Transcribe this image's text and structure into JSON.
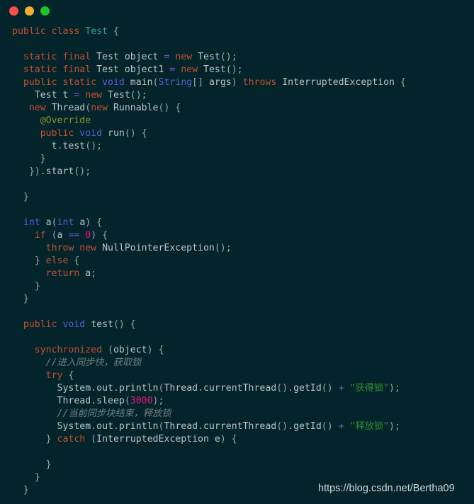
{
  "window": {
    "title": "",
    "traffic_lights": [
      {
        "name": "close",
        "color": "#fc4e4b"
      },
      {
        "name": "minimize",
        "color": "#f5ad2e"
      },
      {
        "name": "maximize",
        "color": "#1dc328"
      }
    ],
    "background": "#04242c"
  },
  "editor": {
    "language": "Java",
    "font_size_px": 13.2,
    "line_height_px": 18,
    "colors": {
      "background": "#04242c",
      "keyword": "#c1502e",
      "type": "#5a5fd4",
      "class_name": "#3a9e8a",
      "identifier": "#b9c4c4",
      "operator": "#7d57c6",
      "number": "#e0197d",
      "string": "#2f8f2f",
      "annotation": "#8a9127",
      "comment": "#6f8081",
      "punctuation": "#9aa7a7"
    },
    "lines": [
      {
        "n": 1,
        "tokens": [
          {
            "t": "kw",
            "v": "public"
          },
          {
            "t": "pun",
            "v": " "
          },
          {
            "t": "kw",
            "v": "class"
          },
          {
            "t": "pun",
            "v": " "
          },
          {
            "t": "cls",
            "v": "Test"
          },
          {
            "t": "pun",
            "v": " {"
          }
        ]
      },
      {
        "n": 2,
        "tokens": []
      },
      {
        "n": 3,
        "tokens": [
          {
            "t": "pun",
            "v": "  "
          },
          {
            "t": "kw",
            "v": "static"
          },
          {
            "t": "pun",
            "v": " "
          },
          {
            "t": "kw",
            "v": "final"
          },
          {
            "t": "pun",
            "v": " "
          },
          {
            "t": "id",
            "v": "Test object "
          },
          {
            "t": "op",
            "v": "="
          },
          {
            "t": "id",
            "v": " "
          },
          {
            "t": "kw",
            "v": "new"
          },
          {
            "t": "id",
            "v": " Test"
          },
          {
            "t": "pun",
            "v": "();"
          }
        ]
      },
      {
        "n": 4,
        "tokens": [
          {
            "t": "pun",
            "v": "  "
          },
          {
            "t": "kw",
            "v": "static"
          },
          {
            "t": "pun",
            "v": " "
          },
          {
            "t": "kw",
            "v": "final"
          },
          {
            "t": "pun",
            "v": " "
          },
          {
            "t": "id",
            "v": "Test object1 "
          },
          {
            "t": "op",
            "v": "="
          },
          {
            "t": "id",
            "v": " "
          },
          {
            "t": "kw",
            "v": "new"
          },
          {
            "t": "id",
            "v": " Test"
          },
          {
            "t": "pun",
            "v": "();"
          }
        ]
      },
      {
        "n": 5,
        "tokens": [
          {
            "t": "pun",
            "v": "  "
          },
          {
            "t": "kw",
            "v": "public"
          },
          {
            "t": "pun",
            "v": " "
          },
          {
            "t": "kw",
            "v": "static"
          },
          {
            "t": "pun",
            "v": " "
          },
          {
            "t": "typ",
            "v": "void"
          },
          {
            "t": "id",
            "v": " main"
          },
          {
            "t": "pun",
            "v": "("
          },
          {
            "t": "typ",
            "v": "String"
          },
          {
            "t": "pun",
            "v": "[] "
          },
          {
            "t": "id",
            "v": "args"
          },
          {
            "t": "pun",
            "v": ") "
          },
          {
            "t": "kw",
            "v": "throws"
          },
          {
            "t": "id",
            "v": " InterruptedException"
          },
          {
            "t": "pun",
            "v": " {"
          }
        ]
      },
      {
        "n": 6,
        "tokens": [
          {
            "t": "pun",
            "v": "    "
          },
          {
            "t": "id",
            "v": "Test t "
          },
          {
            "t": "op",
            "v": "="
          },
          {
            "t": "id",
            "v": " "
          },
          {
            "t": "kw",
            "v": "new"
          },
          {
            "t": "id",
            "v": " Test"
          },
          {
            "t": "pun",
            "v": "();"
          }
        ]
      },
      {
        "n": 7,
        "tokens": [
          {
            "t": "pun",
            "v": "   "
          },
          {
            "t": "kw",
            "v": "new"
          },
          {
            "t": "id",
            "v": " Thread"
          },
          {
            "t": "pun",
            "v": "("
          },
          {
            "t": "kw",
            "v": "new"
          },
          {
            "t": "id",
            "v": " Runnable"
          },
          {
            "t": "pun",
            "v": "() {"
          }
        ]
      },
      {
        "n": 8,
        "tokens": [
          {
            "t": "pun",
            "v": "     "
          },
          {
            "t": "ann",
            "v": "@Override"
          }
        ]
      },
      {
        "n": 9,
        "tokens": [
          {
            "t": "pun",
            "v": "     "
          },
          {
            "t": "kw",
            "v": "public"
          },
          {
            "t": "pun",
            "v": " "
          },
          {
            "t": "typ",
            "v": "void"
          },
          {
            "t": "id",
            "v": " run"
          },
          {
            "t": "pun",
            "v": "() {"
          }
        ]
      },
      {
        "n": 10,
        "tokens": [
          {
            "t": "pun",
            "v": "       "
          },
          {
            "t": "id",
            "v": "t"
          },
          {
            "t": "pun",
            "v": "."
          },
          {
            "t": "id",
            "v": "test"
          },
          {
            "t": "pun",
            "v": "();"
          }
        ]
      },
      {
        "n": 11,
        "tokens": [
          {
            "t": "pun",
            "v": "     }"
          }
        ]
      },
      {
        "n": 12,
        "tokens": [
          {
            "t": "pun",
            "v": "   })."
          },
          {
            "t": "id",
            "v": "start"
          },
          {
            "t": "pun",
            "v": "();"
          }
        ]
      },
      {
        "n": 13,
        "tokens": []
      },
      {
        "n": 14,
        "tokens": [
          {
            "t": "pun",
            "v": "  }"
          }
        ]
      },
      {
        "n": 15,
        "tokens": []
      },
      {
        "n": 16,
        "tokens": [
          {
            "t": "pun",
            "v": "  "
          },
          {
            "t": "typ",
            "v": "int"
          },
          {
            "t": "id",
            "v": " a"
          },
          {
            "t": "pun",
            "v": "("
          },
          {
            "t": "typ",
            "v": "int"
          },
          {
            "t": "id",
            "v": " a"
          },
          {
            "t": "pun",
            "v": ") {"
          }
        ]
      },
      {
        "n": 17,
        "tokens": [
          {
            "t": "pun",
            "v": "    "
          },
          {
            "t": "kw",
            "v": "if"
          },
          {
            "t": "pun",
            "v": " ("
          },
          {
            "t": "id",
            "v": "a "
          },
          {
            "t": "op",
            "v": "=="
          },
          {
            "t": "id",
            "v": " "
          },
          {
            "t": "num",
            "v": "0"
          },
          {
            "t": "pun",
            "v": ") {"
          }
        ]
      },
      {
        "n": 18,
        "tokens": [
          {
            "t": "pun",
            "v": "      "
          },
          {
            "t": "kw",
            "v": "throw"
          },
          {
            "t": "pun",
            "v": " "
          },
          {
            "t": "kw",
            "v": "new"
          },
          {
            "t": "id",
            "v": " NullPointerException"
          },
          {
            "t": "pun",
            "v": "();"
          }
        ]
      },
      {
        "n": 19,
        "tokens": [
          {
            "t": "pun",
            "v": "    } "
          },
          {
            "t": "kw",
            "v": "else"
          },
          {
            "t": "pun",
            "v": " {"
          }
        ]
      },
      {
        "n": 20,
        "tokens": [
          {
            "t": "pun",
            "v": "      "
          },
          {
            "t": "kw",
            "v": "return"
          },
          {
            "t": "id",
            "v": " a"
          },
          {
            "t": "pun",
            "v": ";"
          }
        ]
      },
      {
        "n": 21,
        "tokens": [
          {
            "t": "pun",
            "v": "    }"
          }
        ]
      },
      {
        "n": 22,
        "tokens": [
          {
            "t": "pun",
            "v": "  }"
          }
        ]
      },
      {
        "n": 23,
        "tokens": []
      },
      {
        "n": 24,
        "tokens": [
          {
            "t": "pun",
            "v": "  "
          },
          {
            "t": "kw",
            "v": "public"
          },
          {
            "t": "pun",
            "v": " "
          },
          {
            "t": "typ",
            "v": "void"
          },
          {
            "t": "id",
            "v": " test"
          },
          {
            "t": "pun",
            "v": "() {"
          }
        ]
      },
      {
        "n": 25,
        "tokens": []
      },
      {
        "n": 26,
        "tokens": [
          {
            "t": "pun",
            "v": "    "
          },
          {
            "t": "kw",
            "v": "synchronized"
          },
          {
            "t": "pun",
            "v": " ("
          },
          {
            "t": "id",
            "v": "object"
          },
          {
            "t": "pun",
            "v": ") {"
          }
        ]
      },
      {
        "n": 27,
        "tokens": [
          {
            "t": "pun",
            "v": "      "
          },
          {
            "t": "cmt",
            "v": "//进入同步快，获取锁"
          }
        ]
      },
      {
        "n": 28,
        "tokens": [
          {
            "t": "pun",
            "v": "      "
          },
          {
            "t": "kw",
            "v": "try"
          },
          {
            "t": "pun",
            "v": " {"
          }
        ]
      },
      {
        "n": 29,
        "tokens": [
          {
            "t": "pun",
            "v": "        "
          },
          {
            "t": "id",
            "v": "System"
          },
          {
            "t": "pun",
            "v": "."
          },
          {
            "t": "id",
            "v": "out"
          },
          {
            "t": "pun",
            "v": "."
          },
          {
            "t": "id",
            "v": "println"
          },
          {
            "t": "pun",
            "v": "("
          },
          {
            "t": "id",
            "v": "Thread"
          },
          {
            "t": "pun",
            "v": "."
          },
          {
            "t": "id",
            "v": "currentThread"
          },
          {
            "t": "pun",
            "v": "()."
          },
          {
            "t": "id",
            "v": "getId"
          },
          {
            "t": "pun",
            "v": "() "
          },
          {
            "t": "op",
            "v": "+"
          },
          {
            "t": "pun",
            "v": " "
          },
          {
            "t": "str",
            "v": "\"获得锁\""
          },
          {
            "t": "pun",
            "v": ");"
          }
        ]
      },
      {
        "n": 30,
        "tokens": [
          {
            "t": "pun",
            "v": "        "
          },
          {
            "t": "id",
            "v": "Thread"
          },
          {
            "t": "pun",
            "v": "."
          },
          {
            "t": "id",
            "v": "sleep"
          },
          {
            "t": "pun",
            "v": "("
          },
          {
            "t": "num",
            "v": "3000"
          },
          {
            "t": "pun",
            "v": ");"
          }
        ]
      },
      {
        "n": 31,
        "tokens": [
          {
            "t": "pun",
            "v": "        "
          },
          {
            "t": "cmt",
            "v": "//当前同步块结束，释放锁"
          }
        ]
      },
      {
        "n": 32,
        "tokens": [
          {
            "t": "pun",
            "v": "        "
          },
          {
            "t": "id",
            "v": "System"
          },
          {
            "t": "pun",
            "v": "."
          },
          {
            "t": "id",
            "v": "out"
          },
          {
            "t": "pun",
            "v": "."
          },
          {
            "t": "id",
            "v": "println"
          },
          {
            "t": "pun",
            "v": "("
          },
          {
            "t": "id",
            "v": "Thread"
          },
          {
            "t": "pun",
            "v": "."
          },
          {
            "t": "id",
            "v": "currentThread"
          },
          {
            "t": "pun",
            "v": "()."
          },
          {
            "t": "id",
            "v": "getId"
          },
          {
            "t": "pun",
            "v": "() "
          },
          {
            "t": "op",
            "v": "+"
          },
          {
            "t": "pun",
            "v": " "
          },
          {
            "t": "str",
            "v": "\"释放锁\""
          },
          {
            "t": "pun",
            "v": ");"
          }
        ]
      },
      {
        "n": 33,
        "tokens": [
          {
            "t": "pun",
            "v": "      } "
          },
          {
            "t": "kw",
            "v": "catch"
          },
          {
            "t": "pun",
            "v": " ("
          },
          {
            "t": "id",
            "v": "InterruptedException e"
          },
          {
            "t": "pun",
            "v": ") {"
          }
        ]
      },
      {
        "n": 34,
        "tokens": []
      },
      {
        "n": 35,
        "tokens": [
          {
            "t": "pun",
            "v": "      }"
          }
        ]
      },
      {
        "n": 36,
        "tokens": [
          {
            "t": "pun",
            "v": "    }"
          }
        ]
      },
      {
        "n": 37,
        "tokens": [
          {
            "t": "pun",
            "v": "  }"
          }
        ]
      }
    ]
  },
  "watermark": {
    "text": "https://blog.csdn.net/Bertha09"
  }
}
